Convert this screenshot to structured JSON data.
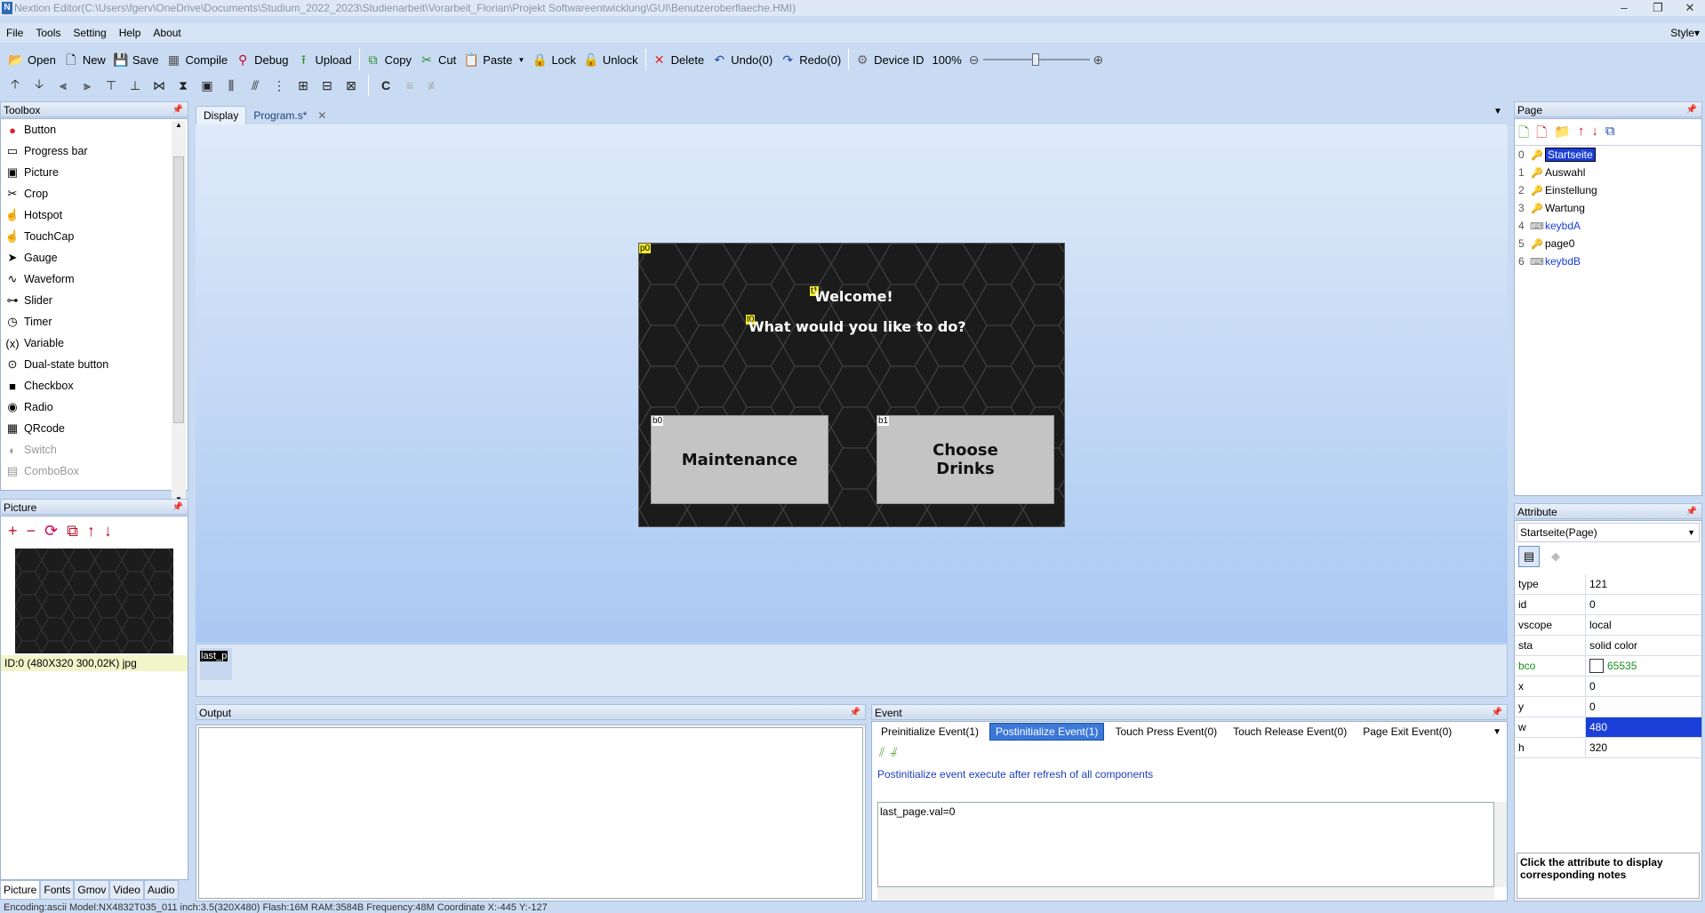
{
  "window": {
    "title": "Nextion Editor(C:\\Users\\fgerv\\OneDrive\\Documents\\Studium_2022_2023\\Studienarbeit\\Vorarbeit_Florian\\Projekt Softwareentwicklung\\GUI\\Benutzeroberflaeche.HMI)",
    "logo": "N"
  },
  "menu": {
    "items": [
      "File",
      "Tools",
      "Setting",
      "Help",
      "About"
    ],
    "style": "Style"
  },
  "toolbar": {
    "open": "Open",
    "new": "New",
    "save": "Save",
    "compile": "Compile",
    "debug": "Debug",
    "upload": "Upload",
    "copy": "Copy",
    "cut": "Cut",
    "paste": "Paste",
    "lock": "Lock",
    "unlock": "Unlock",
    "delete": "Delete",
    "undo": "Undo(0)",
    "redo": "Redo(0)",
    "device_id": "Device  ID",
    "zoom": "100%"
  },
  "toolbox": {
    "title": "Toolbox",
    "items": [
      {
        "label": "Button",
        "icon": "button-icon",
        "color": "#d8262d"
      },
      {
        "label": "Progress bar",
        "icon": "progress-bar-icon"
      },
      {
        "label": "Picture",
        "icon": "picture-icon"
      },
      {
        "label": "Crop",
        "icon": "crop-icon"
      },
      {
        "label": "Hotspot",
        "icon": "hotspot-icon"
      },
      {
        "label": "TouchCap",
        "icon": "touchcap-icon"
      },
      {
        "label": "Gauge",
        "icon": "gauge-icon"
      },
      {
        "label": "Waveform",
        "icon": "waveform-icon"
      },
      {
        "label": "Slider",
        "icon": "slider-icon"
      },
      {
        "label": "Timer",
        "icon": "timer-icon"
      },
      {
        "label": "Variable",
        "icon": "variable-icon"
      },
      {
        "label": "Dual-state button",
        "icon": "dual-state-icon"
      },
      {
        "label": "Checkbox",
        "icon": "checkbox-icon"
      },
      {
        "label": "Radio",
        "icon": "radio-icon"
      },
      {
        "label": "QRcode",
        "icon": "qrcode-icon"
      },
      {
        "label": "Switch",
        "icon": "switch-icon",
        "disabled": true
      },
      {
        "label": "ComboBox",
        "icon": "combobox-icon",
        "disabled": true
      }
    ]
  },
  "picture_panel": {
    "title": "Picture",
    "item_caption": "ID:0  (480X320 300,02K) jpg"
  },
  "bottom_tabs": [
    "Picture",
    "Fonts",
    "Gmov",
    "Video",
    "Audio"
  ],
  "doc_tabs": [
    "Display",
    "Program.s*"
  ],
  "canvas": {
    "page_tag": "p0",
    "welcome_tag": "t1",
    "welcome": "Welcome!",
    "question_tag": "t0",
    "question": "What would you like to do?",
    "b0_tag": "b0",
    "b0_label": "Maintenance",
    "b1_tag": "b1",
    "b1_label": "Choose\nDrinks"
  },
  "variable_bar": {
    "variable": "last_p"
  },
  "output": {
    "title": "Output"
  },
  "event": {
    "title": "Event",
    "tabs": [
      "Preinitialize Event(1)",
      "Postinitialize Event(1)",
      "Touch Press Event(0)",
      "Touch Release Event(0)",
      "Page Exit Event(0)"
    ],
    "active_tab": 1,
    "description": "Postinitialize event execute after refresh of all components",
    "code": "last_page.val=0"
  },
  "page_panel": {
    "title": "Page",
    "pages": [
      {
        "num": "0",
        "name": "Startseite",
        "selected": true
      },
      {
        "num": "1",
        "name": "Auswahl"
      },
      {
        "num": "2",
        "name": "Einstellung"
      },
      {
        "num": "3",
        "name": "Wartung"
      },
      {
        "num": "4",
        "name": "keybdA",
        "blue": true
      },
      {
        "num": "5",
        "name": "page0"
      },
      {
        "num": "6",
        "name": "keybdB",
        "blue": true
      }
    ]
  },
  "attribute_panel": {
    "title": "Attribute",
    "selector": "Startseite(Page)",
    "rows": [
      {
        "k": "type",
        "v": "121"
      },
      {
        "k": "id",
        "v": "0"
      },
      {
        "k": "vscope",
        "v": "local"
      },
      {
        "k": "sta",
        "v": "solid color"
      },
      {
        "k": "bco",
        "v": "65535",
        "green": true,
        "swatch": "#ffffff"
      },
      {
        "k": "x",
        "v": "0"
      },
      {
        "k": "y",
        "v": "0"
      },
      {
        "k": "w",
        "v": "480",
        "highlight": true
      },
      {
        "k": "h",
        "v": "320"
      }
    ],
    "note": "Click the attribute to display corresponding notes"
  },
  "statusbar": {
    "text": "Encoding:ascii  Model:NX4832T035_011  inch:3.5(320X480) Flash:16M RAM:3584B Frequency:48M   Coordinate X:-445  Y:-127"
  }
}
